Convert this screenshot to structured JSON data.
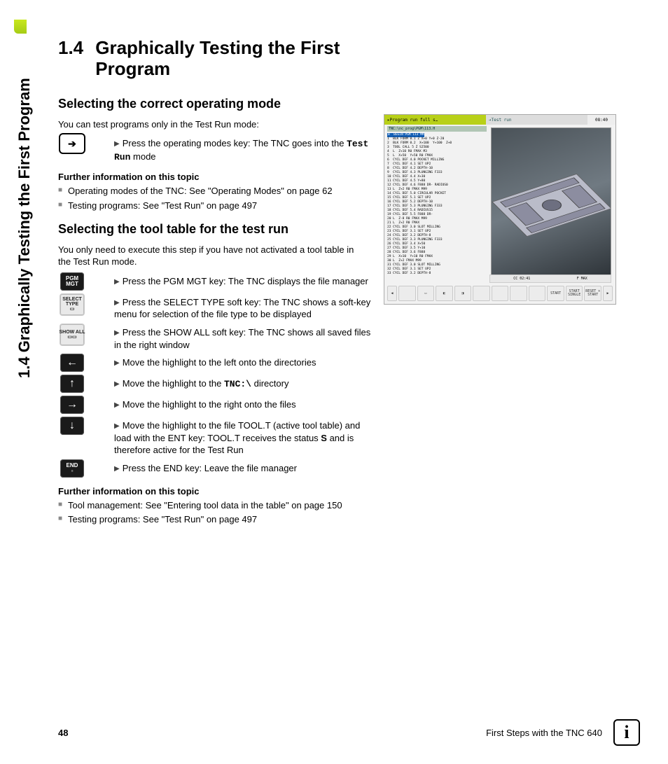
{
  "side_title": "1.4 Graphically Testing the First Program",
  "heading": {
    "number": "1.4",
    "text": "Graphically Testing the First Program"
  },
  "section1": {
    "title": "Selecting the correct operating mode",
    "intro": "You can test programs only in the Test Run mode:",
    "step1_pre": "Press the operating modes key: The TNC goes into the ",
    "step1_mono": "Test Run",
    "step1_post": " mode",
    "further_label": "Further information on this topic",
    "bullets": [
      "Operating modes of the TNC: See \"Operating Modes\" on page 62",
      "Testing programs: See \"Test Run\" on page 497"
    ]
  },
  "section2": {
    "title": "Selecting the tool table for the test run",
    "intro": "You only need to execute this step if you have not activated a tool table in the Test Run mode.",
    "steps": [
      {
        "key_style": "dark",
        "key_label": "PGM\nMGT",
        "text": "Press the PGM MGT key: The TNC displays the file manager"
      },
      {
        "key_style": "light",
        "key_label": "SELECT\nTYPE",
        "key_icon": "page",
        "text": "Press the SELECT TYPE soft key: The TNC shows a soft-key menu for selection of the file type to be displayed"
      },
      {
        "key_style": "light",
        "key_label": "SHOW ALL",
        "key_icon": "pages",
        "text": "Press the SHOW ALL soft key: The TNC shows all saved files in the right window"
      },
      {
        "key_style": "dark",
        "key_arrow": "←",
        "text": "Move the highlight to the left onto the directories"
      },
      {
        "key_style": "dark",
        "key_arrow": "↑",
        "text_pre": "Move the highlight to the ",
        "text_mono": "TNC:\\",
        "text_post": " directory"
      },
      {
        "key_style": "dark",
        "key_arrow": "→",
        "text": "Move the highlight to the right onto the files"
      },
      {
        "key_style": "dark",
        "key_arrow": "↓",
        "text_pre": "Move the highlight to the file TOOL.T (active tool table) and load with the ENT key: TOOL.T receives the status ",
        "text_bold": "S",
        "text_post": " and is therefore active for the Test Run"
      },
      {
        "key_style": "dark",
        "key_label": "END",
        "key_sub": "▫",
        "text": "Press the END key: Leave the file manager"
      }
    ],
    "further_label": "Further information on this topic",
    "bullets": [
      "Tool management: See \"Entering tool data in the table\" on page 150",
      "Testing programs: See \"Test Run\" on page 497"
    ]
  },
  "screenshot": {
    "title_left": "Program run full s…",
    "title_right": "Test run",
    "title_time": "08:40",
    "filebar": "TNC:\\nc_prog\\PGM\\113.H",
    "code_lines": [
      "0  BEGIN PGM 113 MM",
      "1  BLK FORM 0.1 Z X+0 Y+0 Z-20",
      "2  BLK FORM 0.2  X+100  Y+100  Z+0",
      "3  TOOL CALL 5 Z S2500",
      "4  L  Z+10 R0 FMAX M3",
      "5  L  X+50  Y+50 R0 FMAX",
      "6  CYCL DEF 4.0 POCKET MILLING",
      "7  CYCL DEF 4.1 SET UP2",
      "8  CYCL DEF 4.2 DEPTH-10",
      "9  CYCL DEF 4.3 PLUNGING F333",
      "10 CYCL DEF 4.4 X+30",
      "11 CYCL DEF 4.5 Y+80",
      "12 CYCL DEF 4.6 F888 DR- RADIUS0",
      "13 L  Z+2 R0 FMAX M99",
      "14 CYCL DEF 5.0 CIRCULAR POCKET",
      "15 CYCL DEF 5.1 SET UP2",
      "16 CYCL DEF 5.2 DEPTH-10",
      "17 CYCL DEF 5.3 PLUNGING F333",
      "18 CYCL DEF 5.4 RADIUS15",
      "19 CYCL DEF 5.5 F888 DR-",
      "20 L  Z-8 R0 FMAX M99",
      "21 L  Z+2 R0 FMAX",
      "22 CYCL DEF 3.0 SLOT MILLING",
      "23 CYCL DEF 3.1 SET UP2",
      "24 CYCL DEF 3.2 DEPTH-8",
      "25 CYCL DEF 3.3 PLUNGING F333",
      "26 CYCL DEF 3.4 X+50",
      "27 CYCL DEF 3.5 Y+10",
      "28 CYCL DEF 3.6 F888",
      "29 L  X+10  Y+10 R0 FMAX",
      "30 L  Z+2 FMAX M99",
      "31 CYCL DEF 3.0 SLOT MILLING",
      "32 CYCL DEF 3.1 SET UP2",
      "33 CYCL DEF 3.2 DEPTH-8"
    ],
    "status_left": "CC 02:41",
    "status_right": "F MAX",
    "softkeys_end": [
      "START",
      "START SINGLE",
      "RESET + START"
    ]
  },
  "footer": {
    "page": "48",
    "book": "First Steps with the TNC 640"
  }
}
